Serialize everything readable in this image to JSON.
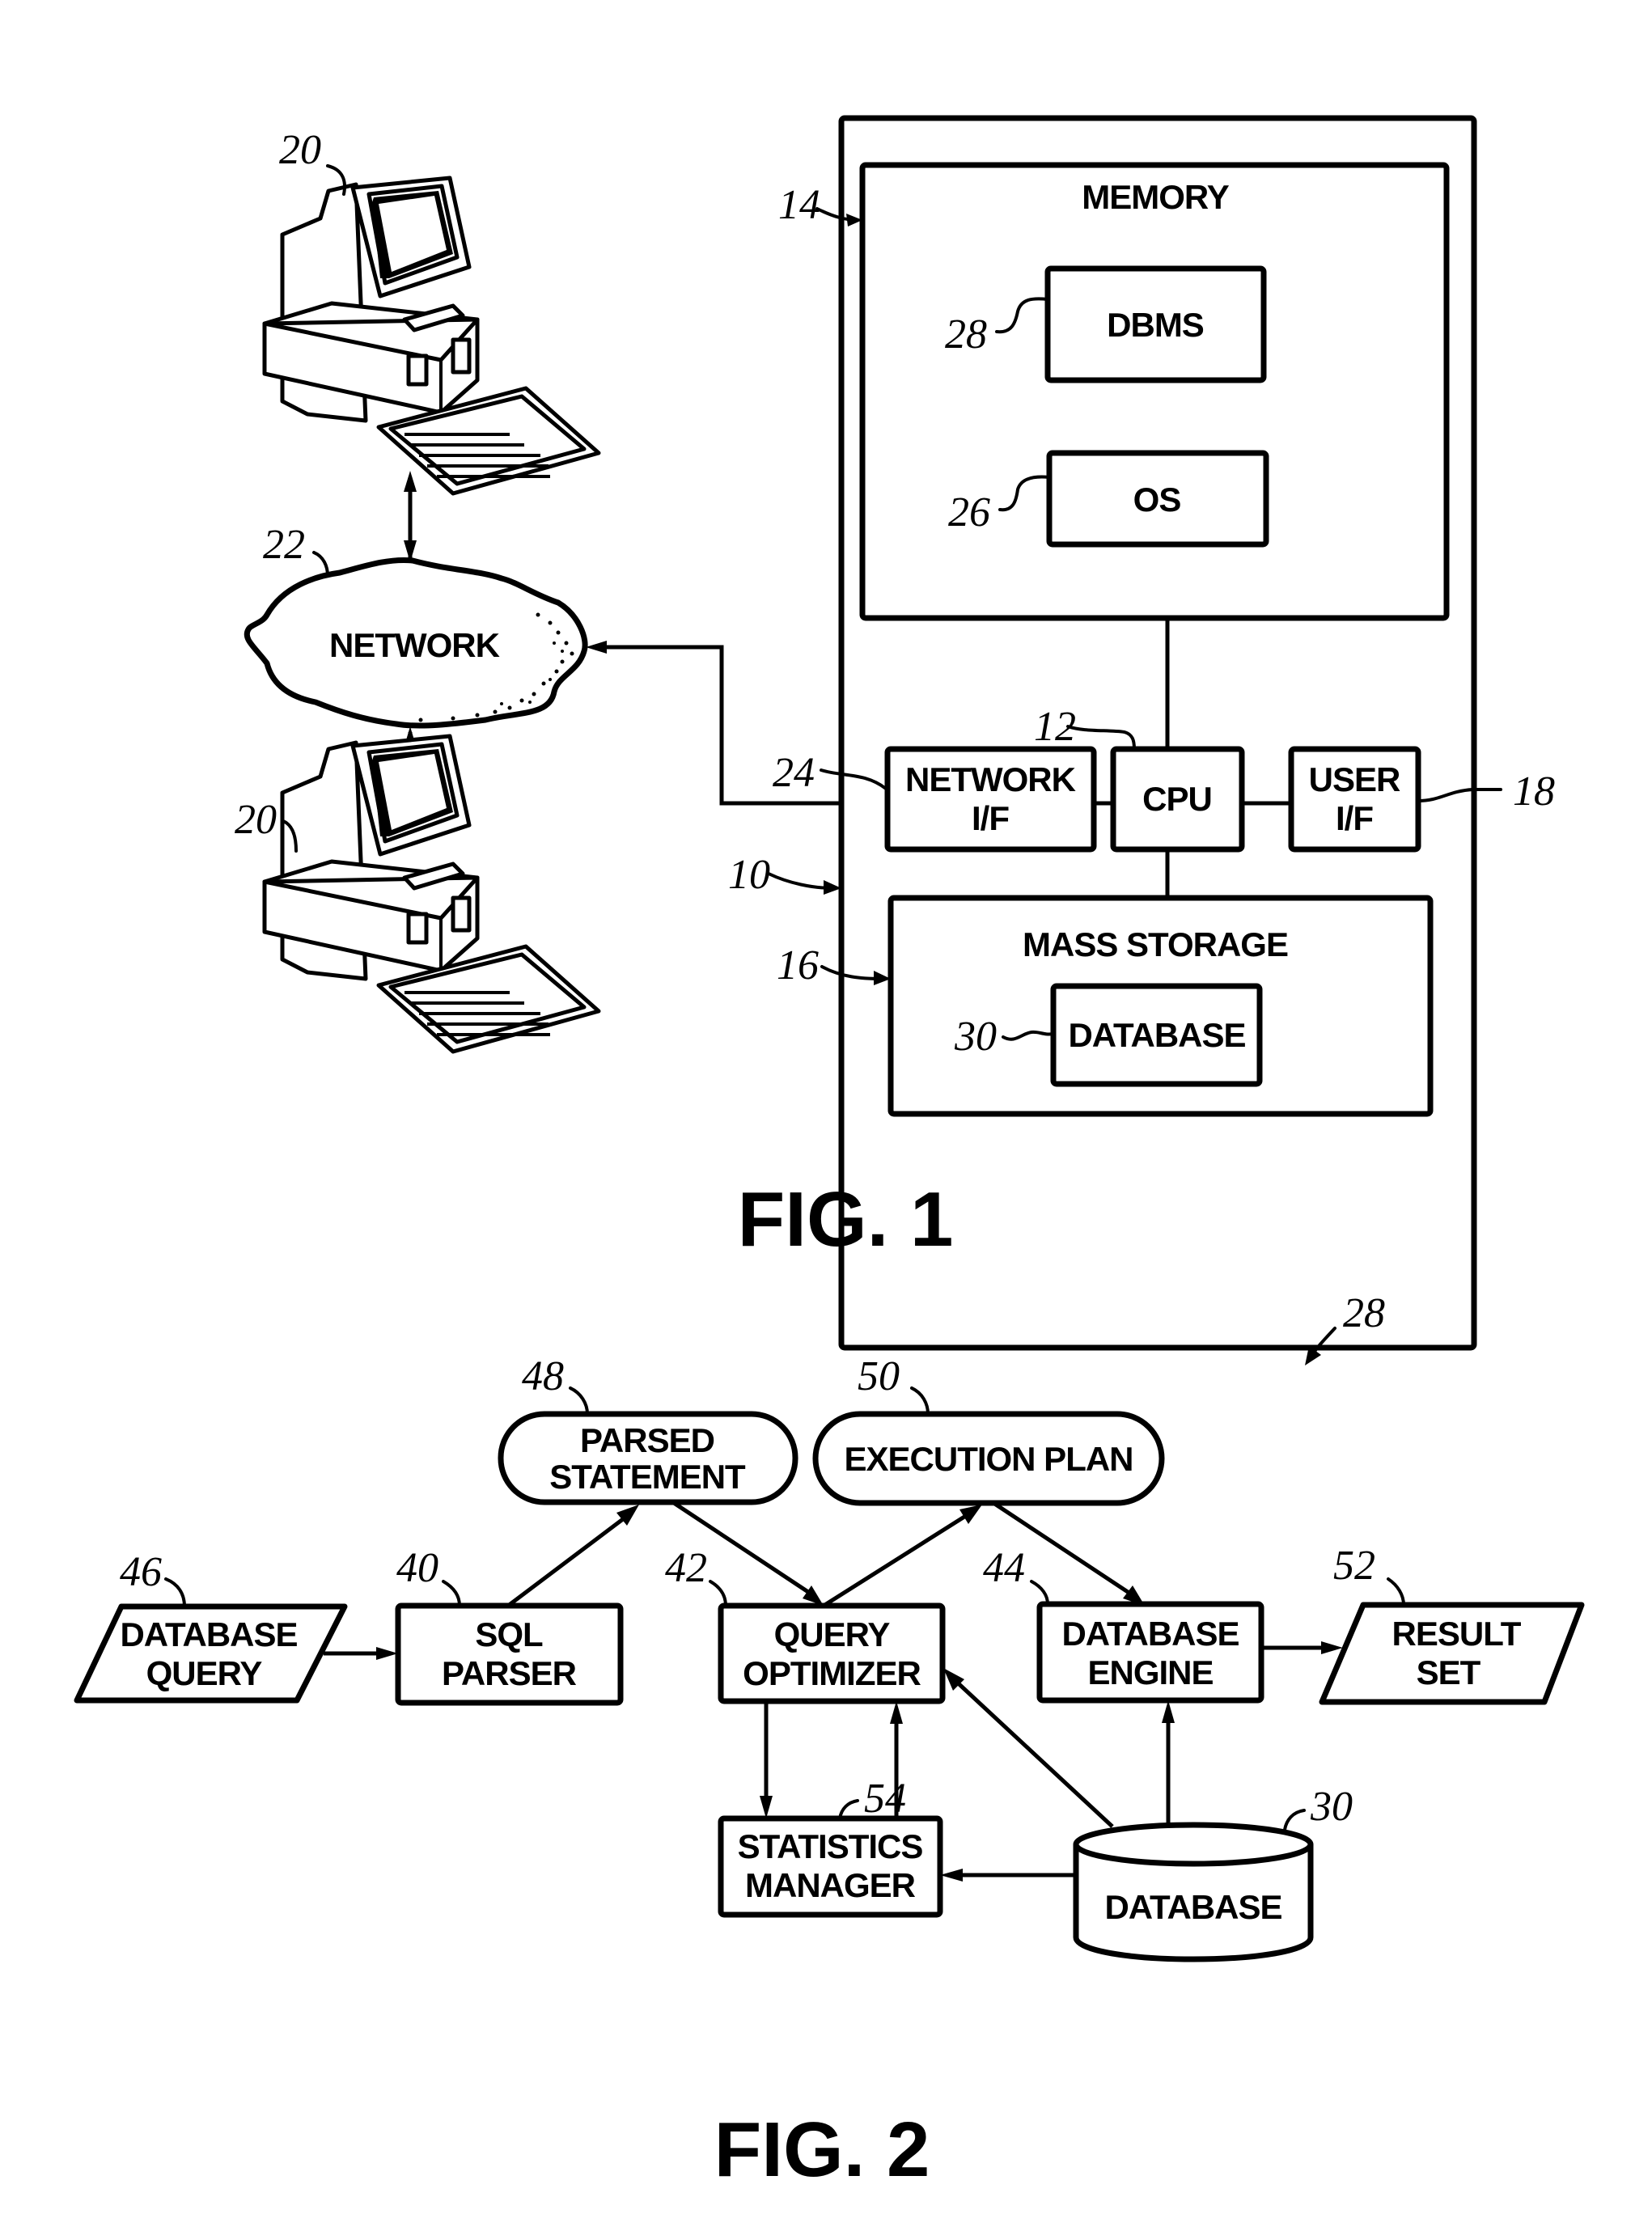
{
  "figure1": {
    "caption": "FIG. 1",
    "network_label": "NETWORK",
    "memory_label": "MEMORY",
    "dbms_label": "DBMS",
    "os_label": "OS",
    "network_if_label_line1": "NETWORK",
    "network_if_label_line2": "I/F",
    "cpu_label": "CPU",
    "user_if_label_line1": "USER",
    "user_if_label_line2": "I/F",
    "mass_storage_label": "MASS STORAGE",
    "database_label": "DATABASE",
    "refs": {
      "computer_system": "10",
      "cpu": "12",
      "memory": "14",
      "mass_storage": "16",
      "user_if": "18",
      "client_top": "20",
      "client_bottom": "20",
      "network": "22",
      "network_if": "24",
      "os": "26",
      "dbms": "28",
      "database": "30"
    }
  },
  "figure2": {
    "caption": "FIG. 2",
    "database_query_line1": "DATABASE",
    "database_query_line2": "QUERY",
    "sql_parser_line1": "SQL",
    "sql_parser_line2": "PARSER",
    "parsed_statement_line1": "PARSED",
    "parsed_statement_line2": "STATEMENT",
    "execution_plan": "EXECUTION PLAN",
    "query_optimizer_line1": "QUERY",
    "query_optimizer_line2": "OPTIMIZER",
    "database_engine_line1": "DATABASE",
    "database_engine_line2": "ENGINE",
    "result_set_line1": "RESULT",
    "result_set_line2": "SET",
    "statistics_manager_line1": "STATISTICS",
    "statistics_manager_line2": "MANAGER",
    "database_label": "DATABASE",
    "refs": {
      "dbms": "28",
      "sql_parser": "40",
      "query_optimizer": "42",
      "database_engine": "44",
      "database_query": "46",
      "parsed_statement": "48",
      "execution_plan": "50",
      "result_set": "52",
      "statistics_manager": "54",
      "database": "30"
    }
  }
}
